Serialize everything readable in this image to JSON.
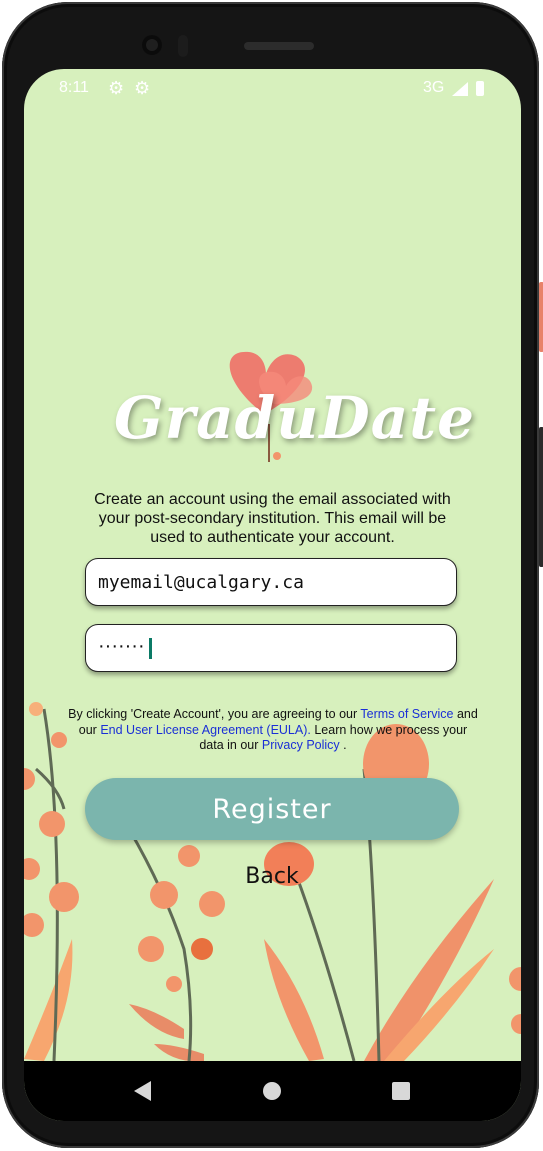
{
  "status_bar": {
    "time": "8:11",
    "network": "3G",
    "icons": [
      "gear-icon",
      "settings-icon",
      "signal-icon",
      "battery-icon"
    ]
  },
  "logo": {
    "text": "GraduDate"
  },
  "intro": {
    "text": "Create an account using the email associated with your post-secondary institution. This email will be used to authenticate your account."
  },
  "form": {
    "email_value": "myemail@ucalgary.ca",
    "password_mask": "·······"
  },
  "terms": {
    "part1": "By clicking 'Create Account', you are agreeing to our",
    "terms_link": "Terms of Service",
    "part2": "and our",
    "eula_link": "End User License Agreement (EULA).",
    "part3": "Learn how we process your data in our",
    "privacy_link": "Privacy Policy",
    "part4": "."
  },
  "actions": {
    "register_label": "Register",
    "back_label": "Back"
  },
  "nav": {
    "icons": [
      "back-triangle-icon",
      "home-circle-icon",
      "recents-square-icon"
    ]
  },
  "colors": {
    "background": "#d7f0bd",
    "register_button": "#7bb5ad",
    "link": "#1a2fd6",
    "flower": "#f2956b"
  }
}
